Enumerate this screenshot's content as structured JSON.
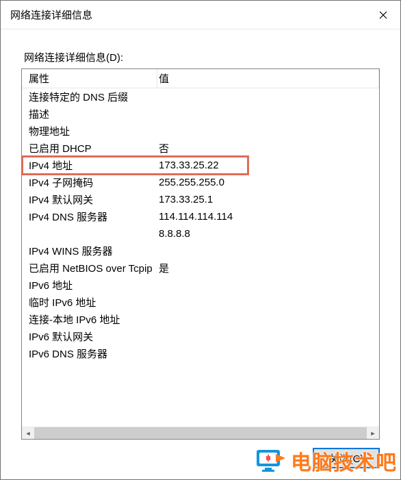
{
  "dialog": {
    "title": "网络连接详细信息",
    "section_label": "网络连接详细信息(D):",
    "headers": {
      "property": "属性",
      "value": "值"
    },
    "rows": [
      {
        "prop": "连接特定的 DNS 后缀",
        "val": ""
      },
      {
        "prop": "描述",
        "val": ""
      },
      {
        "prop": "物理地址",
        "val": ""
      },
      {
        "prop": "已启用 DHCP",
        "val": "否"
      },
      {
        "prop": "IPv4 地址",
        "val": "173.33.25.22",
        "highlight": true
      },
      {
        "prop": "IPv4 子网掩码",
        "val": "255.255.255.0"
      },
      {
        "prop": "IPv4 默认网关",
        "val": "173.33.25.1"
      },
      {
        "prop": "IPv4 DNS 服务器",
        "val": "114.114.114.114"
      },
      {
        "prop": "",
        "val": "8.8.8.8"
      },
      {
        "prop": "IPv4 WINS 服务器",
        "val": ""
      },
      {
        "prop": "已启用 NetBIOS over Tcpip",
        "val": "是"
      },
      {
        "prop": "IPv6 地址",
        "val": ""
      },
      {
        "prop": "临时 IPv6 地址",
        "val": ""
      },
      {
        "prop": "连接-本地 IPv6 地址",
        "val": ""
      },
      {
        "prop": "IPv6 默认网关",
        "val": ""
      },
      {
        "prop": "IPv6 DNS 服务器",
        "val": ""
      }
    ],
    "close_button": "关闭(C)"
  },
  "watermark": {
    "text": "电脑技术吧"
  }
}
